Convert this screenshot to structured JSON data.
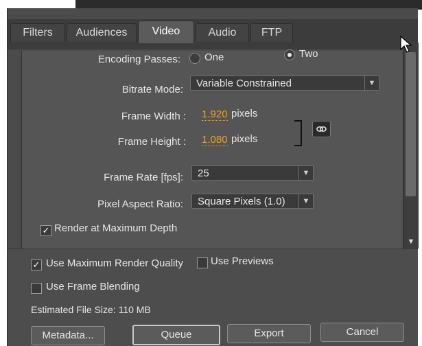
{
  "tabs": [
    {
      "label": "Filters",
      "active": false
    },
    {
      "label": "Audiences",
      "active": false
    },
    {
      "label": "Video",
      "active": true
    },
    {
      "label": "Audio",
      "active": false
    },
    {
      "label": "FTP",
      "active": false
    }
  ],
  "video": {
    "encoding_passes": {
      "label": "Encoding Passes:",
      "options": [
        "One",
        "Two"
      ],
      "selected": "Two"
    },
    "bitrate_mode": {
      "label": "Bitrate Mode:",
      "value": "Variable Constrained"
    },
    "frame_width": {
      "label": "Frame Width :",
      "value": "1.920",
      "unit": "pixels"
    },
    "frame_height": {
      "label": "Frame Height :",
      "value": "1.080",
      "unit": "pixels"
    },
    "frame_rate": {
      "label": "Frame Rate [fps]:",
      "value": "25"
    },
    "pixel_aspect": {
      "label": "Pixel Aspect Ratio:",
      "value": "Square Pixels (1.0)"
    },
    "render_max_depth": {
      "label": "Render at Maximum Depth",
      "checked": true
    }
  },
  "options": {
    "max_render_quality": {
      "label": "Use Maximum Render Quality",
      "checked": true
    },
    "use_previews": {
      "label": "Use Previews",
      "checked": false
    },
    "frame_blending": {
      "label": "Use Frame Blending",
      "checked": false
    },
    "estimated_size": "Estimated File Size: 110 MB"
  },
  "buttons": {
    "metadata": "Metadata...",
    "queue": "Queue",
    "export": "Export",
    "cancel": "Cancel"
  },
  "icons": {
    "link": "link-icon",
    "cursor": "mouse-pointer-icon",
    "dropdown": "chevron-down-icon"
  }
}
